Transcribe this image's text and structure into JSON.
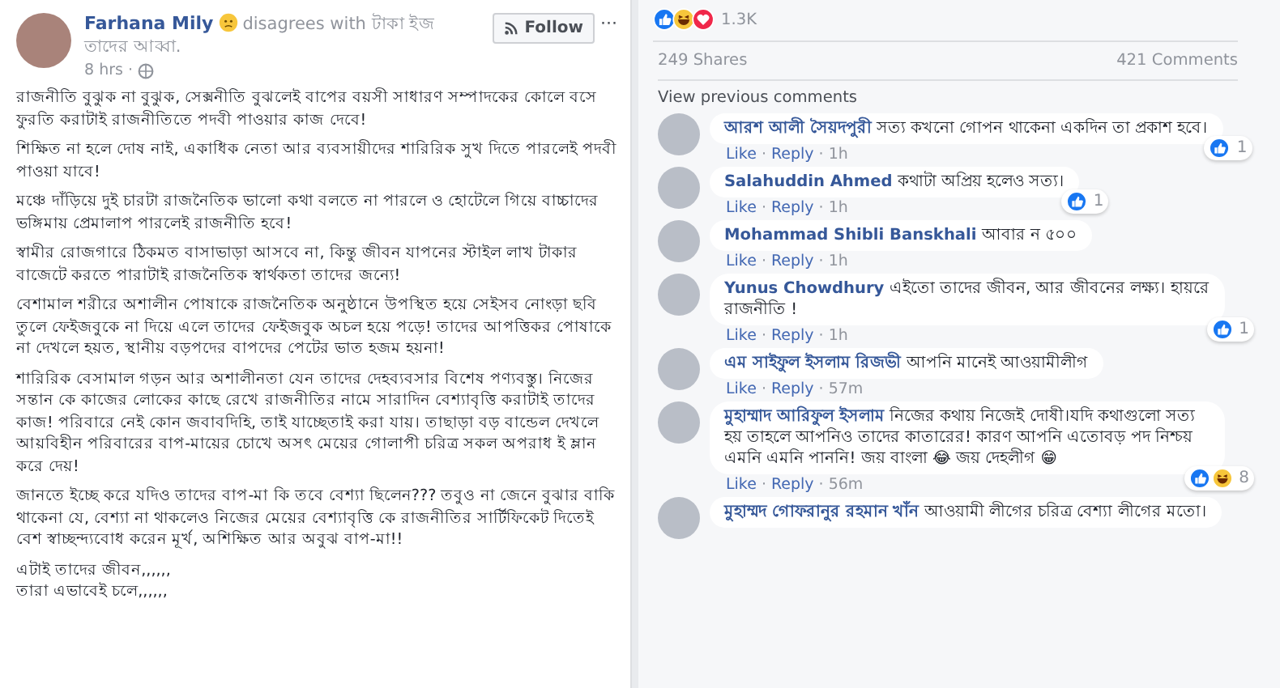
{
  "post": {
    "author": "Farhana Mily",
    "activity": "disagrees with টাকা ইজ তাদের আব্বা.",
    "time": "8 hrs ·",
    "follow_button": "Follow",
    "more": "···",
    "paragraphs": [
      "রাজনীতি বুঝুক না বুঝুক, সেক্সনীতি বুঝলেই বাপের বয়সী সাধারণ সম্পাদকের কোলে বসে ফুরতি করাটাই রাজনীতিতে পদবী পাওয়ার কাজ দেবে!",
      "শিক্ষিত না হলে দোষ নাই, একাধিক নেতা আর ব্যবসায়ীদের শারিরিক সুখ দিতে পারলেই পদবী পাওয়া যাবে!",
      "মঞ্চে দাঁড়িয়ে দুই চারটা রাজনৈতিক ভালো কথা বলতে না পারলে ও হোটেলে গিয়ে বাচ্চাদের ভঙ্গিমায় প্রেমালাপ পারলেই রাজনীতি হবে!",
      "স্বামীর রোজগারে ঠিকমত বাসাভাড়া আসবে না, কিন্তু জীবন যাপনের স্টাইল লাখ টাকার বাজেটে করতে পারাটাই রাজনৈতিক স্বার্থকতা তাদের জন্যে!",
      "বেশামাল শরীরে অশালীন পোষাকে রাজনৈতিক অনুষ্ঠানে উপস্থিত হয়ে সেইসব নোংড়া ছবি তুলে ফেইজবুকে না দিয়ে এলে তাদের ফেইজবুক অচল হয়ে পড়ে! তাদের আপত্তিকর পোষাকে না দেখলে হয়ত, স্থানীয় বড়পদের বাপদের পেটের ভাত হজম হয়না!",
      "শারিরিক বেসামাল গড়ন আর অশালীনতা যেন তাদের দেহব্যবসার বিশেষ পণ্যবস্তু। নিজের সন্তান কে কাজের লোকের কাছে রেখে রাজনীতির নামে সারাদিন বেশ্যাবৃত্তি করাটাই তাদের কাজ! পরিবারে নেই কোন জবাবদিহি, তাই যাচ্ছেতাই করা যায়। তাছাড়া বড় বান্ডেল দেখলে আয়বিহীন পরিবারের বাপ-মায়ের চোখে অসৎ মেয়ের গোলাপী চরিত্র সকল অপরাধ ই ম্লান করে দেয়!",
      "জানতে ইচ্ছে করে যদিও তাদের বাপ-মা কি তবে বেশ্যা ছিলেন??? তবুও না জেনে বুঝার বাকি থাকেনা যে, বেশ্যা না থাকলেও নিজের মেয়ের বেশ্যাবৃত্তি কে রাজনীতির সার্টিফিকেট দিতেই বেশ স্বাচ্ছন্দ্যবোধ করেন মূর্খ, অশিক্ষিত আর অবুঝ বাপ-মা!!"
    ],
    "closing_lines": [
      "এটাই তাদের জীবন,,,,,,",
      "তারা এভাবেই চলে,,,,,,"
    ]
  },
  "reactions": {
    "kinds": [
      {
        "kind": "like"
      },
      {
        "kind": "haha"
      },
      {
        "kind": "love"
      }
    ],
    "count": "1.3K"
  },
  "shares": "249 Shares",
  "comments_count": "421 Comments",
  "view_previous": "View previous comments",
  "comments": [
    {
      "name": "আরশ আলী সৈয়দপুরী",
      "text": "সত্য কখনো গোপন থাকেনা একদিন তা প্রকাশ হবে।",
      "like": "Like",
      "separator": "·",
      "reply": "Reply",
      "time": "1h",
      "reactions": [
        {
          "kind": "like"
        }
      ],
      "reaction_count": "1"
    },
    {
      "name": "Salahuddin Ahmed",
      "text": "কথাটা অপ্রিয় হলেও সত্য।",
      "like": "Like",
      "separator": "·",
      "reply": "Reply",
      "time": "1h",
      "reactions": [
        {
          "kind": "like"
        }
      ],
      "reaction_count": "1"
    },
    {
      "name": "Mohammad Shibli Banskhali",
      "text": "আবার ন ৫০০",
      "like": "Like",
      "separator": "·",
      "reply": "Reply",
      "time": "1h"
    },
    {
      "name": "Yunus Chowdhury",
      "text": "এইতো তাদের জীবন, আর জীবনের লক্ষ্য। হায়রে রাজনীতি !",
      "like": "Like",
      "separator": "·",
      "reply": "Reply",
      "time": "1h",
      "reactions": [
        {
          "kind": "like"
        }
      ],
      "reaction_count": "1"
    },
    {
      "name": "এম সাইফুল ইসলাম রিজভী",
      "text": "আপনি মানেই আওয়ামীলীগ",
      "like": "Like",
      "separator": "·",
      "reply": "Reply",
      "time": "57m"
    },
    {
      "name": "মুহাম্মাদ আরিফুল ইসলাম",
      "text": "নিজের কথায় নিজেই দোষী।যদি কথাগুলো সত্য হয় তাহলে আপনিও তাদের কাতারের! কারণ আপনি এতোবড় পদ নিশ্চয় এমনি এমনি পাননি! জয় বাংলা 😂 জয় দেহলীগ 😁",
      "like": "Like",
      "separator": "·",
      "reply": "Reply",
      "time": "56m",
      "reactions": [
        {
          "kind": "like"
        },
        {
          "kind": "haha"
        }
      ],
      "reaction_count": "8"
    },
    {
      "name": "মুহাম্মদ গোফরানুর রহমান খাঁন",
      "text": "আওয়ামী লীগের চরিত্র বেশ্যা লীগের মতো।"
    }
  ]
}
